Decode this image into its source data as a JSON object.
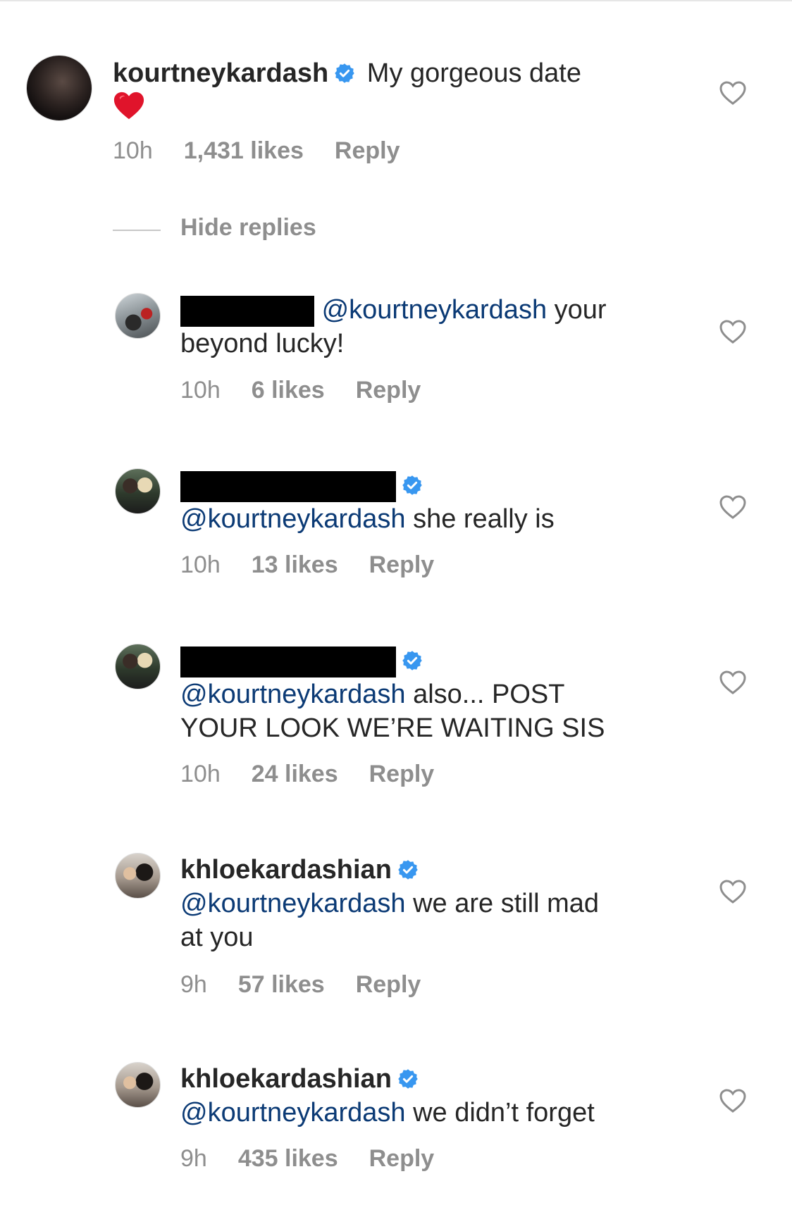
{
  "main_comment": {
    "username": "kourtneykardash",
    "verified": true,
    "text": "My gorgeous date",
    "emoji": "red-heart",
    "time": "10h",
    "likes": "1,431 likes",
    "reply_label": "Reply"
  },
  "hide_replies_label": "Hide replies",
  "replies": [
    {
      "redacted": true,
      "verified": false,
      "mention": "@kourtneykardash",
      "text_inline": "your",
      "text_cont": "beyond lucky!",
      "time": "10h",
      "likes": "6 likes",
      "reply_label": "Reply"
    },
    {
      "redacted": true,
      "verified": true,
      "mention": "@kourtneykardash",
      "text_inline": "she really is",
      "time": "10h",
      "likes": "13 likes",
      "reply_label": "Reply"
    },
    {
      "redacted": true,
      "verified": true,
      "mention": "@kourtneykardash",
      "text_inline": "also... POST",
      "text_cont": "YOUR LOOK WE’RE WAITING SIS",
      "time": "10h",
      "likes": "24 likes",
      "reply_label": "Reply"
    },
    {
      "username": "khloekardashian",
      "verified": true,
      "mention": "@kourtneykardash",
      "text_inline": "we are still mad",
      "text_cont": "at you",
      "time": "9h",
      "likes": "57 likes",
      "reply_label": "Reply"
    },
    {
      "username": "khloekardashian",
      "verified": true,
      "mention": "@kourtneykardash",
      "text_inline": "we didn’t forget",
      "time": "9h",
      "likes": "435 likes",
      "reply_label": "Reply"
    }
  ],
  "icons": {
    "verified": "verified-badge-icon",
    "like": "heart-outline-icon"
  },
  "colors": {
    "verified_blue": "#3897f0",
    "mention_blue": "#0b3a75",
    "meta_gray": "#8e8e8e",
    "heart_red": "#e0142b"
  }
}
